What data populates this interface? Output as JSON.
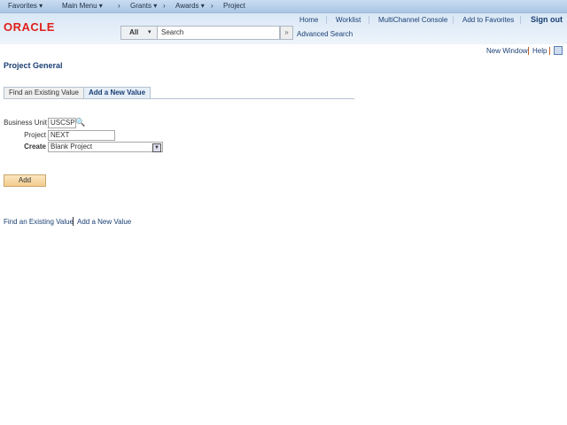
{
  "nav": {
    "favorites": "Favorites ▾",
    "main_menu": "Main Menu ▾",
    "sep": "›",
    "grants": "Grants ▾",
    "awards": "Awards ▾",
    "project": "Project"
  },
  "header": {
    "logo": "ORACLE",
    "home": "Home",
    "worklist": "Worklist",
    "multichannel": "MultiChannel Console",
    "add_favorites": "Add to Favorites",
    "sign_out": "Sign out",
    "search_scope": "All",
    "search_placeholder": "Search",
    "advanced_search": "Advanced Search"
  },
  "util": {
    "new_window": "New Window",
    "help": "Help"
  },
  "page": {
    "title": "Project General",
    "tabs": [
      {
        "label": "Find an Existing Value"
      },
      {
        "label": "Add a New Value"
      }
    ]
  },
  "form": {
    "business_unit_label": "Business Unit",
    "business_unit": "USCSP",
    "project_label": "Project",
    "project": "NEXT",
    "create_label": "Create",
    "create": "Blank Project",
    "add": "Add"
  },
  "footer": {
    "find": "Find an Existing Value",
    "add_new": "Add a New Value"
  },
  "colors": {
    "oracle_red": "#e0201b",
    "link": "#1a3f73",
    "button": "#f7d9a6"
  }
}
